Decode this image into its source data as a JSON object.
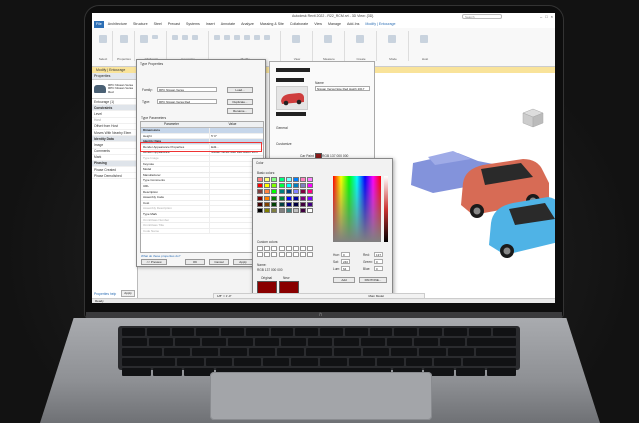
{
  "app": {
    "title": "Autodesk Revit 2022 - R22_RCM.rvt - 3D View: {3D}",
    "search_placeholder": "Search",
    "file_tab": "File",
    "tabs": [
      "Architecture",
      "Structure",
      "Steel",
      "Precast",
      "Systems",
      "Insert",
      "Annotate",
      "Analyze",
      "Massing & Site",
      "Collaborate",
      "View",
      "Manage",
      "Add-Ins",
      "Modify | Entourage"
    ],
    "ribbon_groups": [
      "Select",
      "Properties",
      "Clipboard",
      "Geometry",
      "Modify",
      "View",
      "Measure",
      "Create",
      "Mode",
      "Host"
    ],
    "context_label": "Modify | Entourage"
  },
  "properties_panel": {
    "title": "Properties",
    "type_name": "RPC Nissan Versa",
    "type_sub": "RPC Nissan Versa Red",
    "instance_label": "Entourage (1)",
    "rows": [
      {
        "k": "Constraints",
        "cat": true
      },
      {
        "k": "Level",
        "cat": false
      },
      {
        "k": "Host",
        "cat": false,
        "dim": true
      },
      {
        "k": "Offset from Host",
        "cat": false
      },
      {
        "k": "Moves With Nearby Elem",
        "cat": false
      },
      {
        "k": "Identity Data",
        "cat": true
      },
      {
        "k": "Image",
        "cat": false
      },
      {
        "k": "Comments",
        "cat": false
      },
      {
        "k": "Mark",
        "cat": false
      },
      {
        "k": "Phasing",
        "cat": true
      },
      {
        "k": "Phase Created",
        "cat": false
      },
      {
        "k": "Phase Demolished",
        "cat": false
      }
    ],
    "help_link": "Properties help",
    "apply": "Apply"
  },
  "type_dialog": {
    "title": "Type Properties",
    "family_label": "Family:",
    "family_value": "RPC Nissan Versa",
    "type_label": "Type:",
    "type_value": "RPC Nissan Versa Red",
    "load_btn": "Load...",
    "duplicate_btn": "Duplicate...",
    "rename_btn": "Rename...",
    "type_params_label": "Type Parameters",
    "col_param": "Parameter",
    "col_value": "Value",
    "rows": [
      {
        "k": "Dimensions",
        "v": "",
        "cat": true
      },
      {
        "k": "Height",
        "v": "5' 0\"",
        "cat": false
      },
      {
        "k": "Identity Data",
        "v": "",
        "cat": true
      },
      {
        "k": "Render Appearance Properties",
        "v": "Edit...",
        "cat": false
      },
      {
        "k": "Render Appearance",
        "v": "Nissan Versa Note Red Hatch 2017",
        "cat": false
      },
      {
        "k": "Type Image",
        "v": "",
        "cat": false,
        "dim": true
      },
      {
        "k": "Keynote",
        "v": "",
        "cat": false
      },
      {
        "k": "Model",
        "v": "",
        "cat": false
      },
      {
        "k": "Manufacturer",
        "v": "",
        "cat": false
      },
      {
        "k": "Type Comments",
        "v": "",
        "cat": false
      },
      {
        "k": "URL",
        "v": "",
        "cat": false
      },
      {
        "k": "Description",
        "v": "",
        "cat": false
      },
      {
        "k": "Assembly Code",
        "v": "",
        "cat": false
      },
      {
        "k": "Cost",
        "v": "",
        "cat": false
      },
      {
        "k": "Assembly Description",
        "v": "",
        "cat": false,
        "dim": true
      },
      {
        "k": "Type Mark",
        "v": "",
        "cat": false
      },
      {
        "k": "OmniClass Number",
        "v": "",
        "cat": false,
        "dim": true
      },
      {
        "k": "OmniClass Title",
        "v": "",
        "cat": false,
        "dim": true
      },
      {
        "k": "Code Name",
        "v": "",
        "cat": false,
        "dim": true
      }
    ],
    "link": "What do these properties do?",
    "preview_btn": "<< Preview",
    "ok_btn": "OK",
    "cancel_btn": "Cancel",
    "apply_btn": "Apply"
  },
  "asset_panel": {
    "name_label": "Name",
    "name_value": "Nissan Versa Note Red Hatch 2017",
    "general_label": "General",
    "customize_label": "Customize",
    "car_paint_label": "Car Paint",
    "car_paint_value": "RGB 137 000 000"
  },
  "color_dialog": {
    "title": "Color",
    "basic_label": "Basic colors:",
    "custom_label": "Custom colors:",
    "name_label": "Name:",
    "name_value": "RGB 137 000 000",
    "original_label": "Original",
    "new_label": "New",
    "hue_label": "Hue:",
    "hue": "0",
    "sat_label": "Sat:",
    "sat": "240",
    "lum_label": "Lum:",
    "lum": "64",
    "red_label": "Red:",
    "red": "137",
    "green_label": "Green:",
    "green": "0",
    "blue_label": "Blue:",
    "blue": "0",
    "add_btn": "Add",
    "pantone_btn": "PANTONE...",
    "ok_btn": "OK",
    "cancel_btn": "Cancel",
    "basic_colors": [
      "#ff8080",
      "#ffff80",
      "#80ff80",
      "#00ff80",
      "#80ffff",
      "#0080ff",
      "#ff80c0",
      "#ff80ff",
      "#ff0000",
      "#ffff00",
      "#80ff00",
      "#00ff40",
      "#00ffff",
      "#0080c0",
      "#8080c0",
      "#ff00ff",
      "#804040",
      "#ff8040",
      "#00ff00",
      "#008080",
      "#004080",
      "#8080ff",
      "#800040",
      "#ff0080",
      "#800000",
      "#ff8000",
      "#008000",
      "#008040",
      "#0000ff",
      "#0000a0",
      "#800080",
      "#8000ff",
      "#400000",
      "#804000",
      "#004000",
      "#004040",
      "#000080",
      "#000040",
      "#400040",
      "#400080",
      "#000000",
      "#808000",
      "#808040",
      "#808080",
      "#408080",
      "#c0c0c0",
      "#400040",
      "#ffffff"
    ],
    "selected_color": "#890000"
  },
  "viewport": {
    "view_scale": "1/8\" = 1'-0\"",
    "status": "Ready",
    "main_model": "Main Model",
    "car_colors": {
      "red": "#d76b55",
      "blue": "#4fb3e6",
      "ghost": "#5a6fd0"
    }
  }
}
